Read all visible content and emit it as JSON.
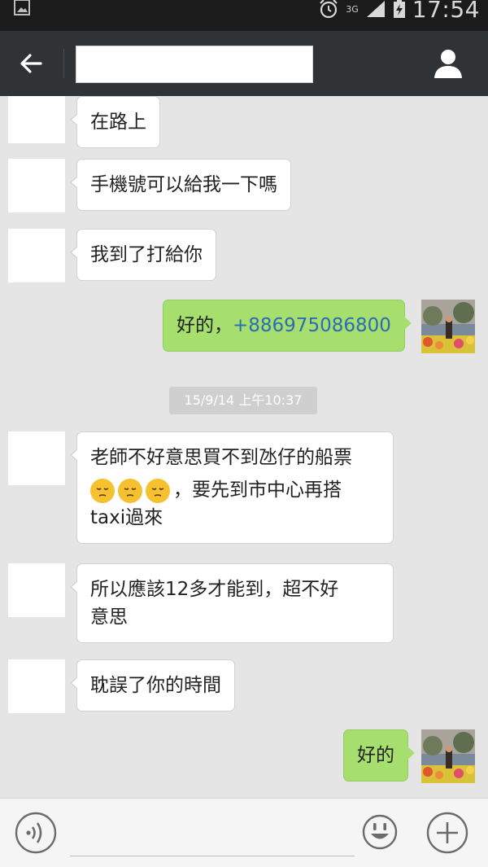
{
  "status_bar": {
    "network": "3G",
    "time": "17:54"
  },
  "header": {
    "title": ""
  },
  "messages": [
    {
      "side": "in",
      "text": "在路上"
    },
    {
      "side": "in",
      "text": "手機號可以給我一下嗎"
    },
    {
      "side": "in",
      "text": "我到了打給你"
    },
    {
      "side": "out",
      "prefix": "好的，",
      "phone": "+886975086800"
    },
    {
      "side": "in",
      "line1": "老師不好意思買不到氹仔的船票",
      "line2": "，要先到市中心再搭",
      "line3": "taxi過來"
    },
    {
      "side": "in",
      "line1": "所以應該12多才能到，超不好",
      "line2": "意思"
    },
    {
      "side": "in",
      "text": "耽誤了你的時間"
    },
    {
      "side": "out",
      "text": "好的"
    }
  ],
  "timestamp": "15/9/14 上午10:37",
  "emoji_name": "pensive-face-emoji",
  "input": {
    "placeholder": ""
  },
  "colors": {
    "outgoing_bubble": "#a6df6d",
    "incoming_bubble": "#ffffff",
    "action_bar": "#303336",
    "phone_link": "#2c6bb5"
  }
}
